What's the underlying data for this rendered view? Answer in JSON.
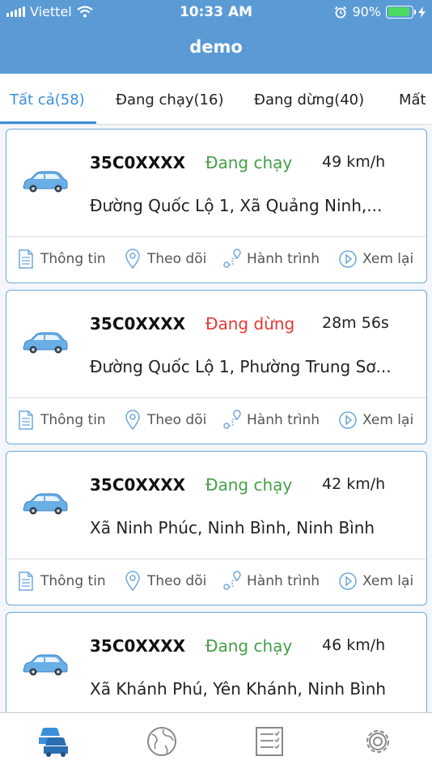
{
  "status_bar": {
    "carrier": "Viettel",
    "time": "10:33 AM",
    "battery": "90%"
  },
  "header": {
    "title": "demo"
  },
  "tabs": [
    {
      "label": "Tất cả(58)",
      "active": true
    },
    {
      "label": "Đang chạy(16)"
    },
    {
      "label": "Đang dừng(40)"
    },
    {
      "label": "Mất"
    }
  ],
  "actions": {
    "info": "Thông tin",
    "track": "Theo dõi",
    "route": "Hành trình",
    "replay": "Xem lại"
  },
  "vehicles": [
    {
      "plate": "35C0XXXX",
      "status": "Đang chạy",
      "metric": "49 km/h",
      "address": "Đường Quốc Lộ 1, Xã Quảng Ninh,..."
    },
    {
      "plate": "35C0XXXX",
      "status": "Đang dừng",
      "metric": "28m 56s",
      "address": "Đường Quốc Lộ 1, Phường Trung Sơ..."
    },
    {
      "plate": "35C0XXXX",
      "status": "Đang chạy",
      "metric": "42 km/h",
      "address": "Xã Ninh Phúc, Ninh Bình, Ninh Bình"
    },
    {
      "plate": "35C0XXXX",
      "status": "Đang chạy",
      "metric": "46 km/h",
      "address": "Xã Khánh Phú, Yên Khánh, Ninh Bình"
    }
  ],
  "colors": {
    "header": "#5b9bd5",
    "accent": "#3a8fd9",
    "running": "#43a047",
    "stopped": "#e53935",
    "card_border": "#6fa8dc"
  },
  "nav": [
    {
      "icon": "vehicles-icon",
      "active": true
    },
    {
      "icon": "globe-icon"
    },
    {
      "icon": "report-list-icon"
    },
    {
      "icon": "settings-gear-icon"
    }
  ]
}
